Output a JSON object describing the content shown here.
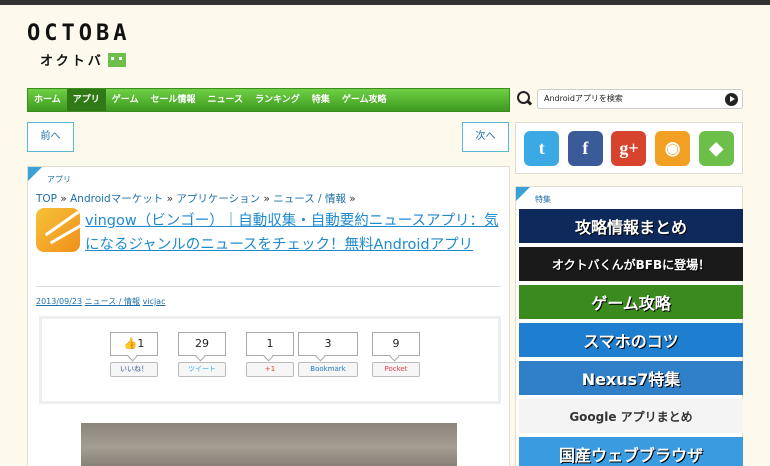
{
  "logo": {
    "main": "OCTOBA",
    "sub": "オクトバ"
  },
  "nav": [
    {
      "label": "ホーム",
      "active": false
    },
    {
      "label": "アプリ",
      "active": true
    },
    {
      "label": "ゲーム",
      "active": false
    },
    {
      "label": "セール情報",
      "active": false
    },
    {
      "label": "ニュース",
      "active": false
    },
    {
      "label": "ランキング",
      "active": false
    },
    {
      "label": "特集",
      "active": false
    },
    {
      "label": "ゲーム攻略",
      "active": false
    }
  ],
  "search": {
    "placeholder": "Androidアプリを検索"
  },
  "pager": {
    "prev": "前へ",
    "next": "次へ"
  },
  "social": [
    {
      "icon": "twitter-icon",
      "glyph": "t",
      "color": "#3ba9e4"
    },
    {
      "icon": "facebook-icon",
      "glyph": "f",
      "color": "#3b5a98"
    },
    {
      "icon": "googleplus-icon",
      "glyph": "g+",
      "color": "#d8432e"
    },
    {
      "icon": "rss-icon",
      "glyph": "◉",
      "color": "#f2a023"
    },
    {
      "icon": "feedly-icon",
      "glyph": "◆",
      "color": "#6cc04a"
    }
  ],
  "article": {
    "category": "アプリ",
    "breadcrumb": [
      "TOP",
      "Androidマーケット",
      "アプリケーション",
      "ニュース / 情報"
    ],
    "title": "vingow（ビンゴー）｜自動収集・自動要約ニュースアプリ：気になるジャンルのニュースをチェック！無料Androidアプリ",
    "date": "2013/09/23",
    "meta_category": "ニュース / 情報",
    "author": "vicjac"
  },
  "share": [
    {
      "count": "👍1",
      "label": "いいね！",
      "icon": "facebook-like-icon",
      "color": "#3b5a98"
    },
    {
      "count": "29",
      "label": "ツイート",
      "icon": "twitter-icon",
      "color": "#3ba9e4"
    },
    {
      "count": "1",
      "label": "+1",
      "icon": "googleplus-icon",
      "color": "#d8432e"
    },
    {
      "count": "3",
      "label": "Bookmark",
      "icon": "hatena-bookmark-icon",
      "color": "#1c7ac4"
    },
    {
      "count": "9",
      "label": "Pocket",
      "icon": "pocket-icon",
      "color": "#e5404e"
    }
  ],
  "sidebar": {
    "label": "特集",
    "banners": [
      {
        "text": "攻略情報まとめ",
        "bg": "#0e2a5c"
      },
      {
        "text": "オクトバくんがBFBに登場！",
        "bg": "#1a1a1a"
      },
      {
        "text": "ゲーム攻略",
        "bg": "#3a8a1e"
      },
      {
        "text": "スマホのコツ",
        "bg": "#1e7fd0"
      },
      {
        "text": "Nexus7特集",
        "bg": "#2f80c9"
      },
      {
        "text": "Google アプリまとめ",
        "bg": "#f4f4f4"
      },
      {
        "text": "国産ウェブブラウザ",
        "bg": "#3a9be0"
      }
    ]
  }
}
